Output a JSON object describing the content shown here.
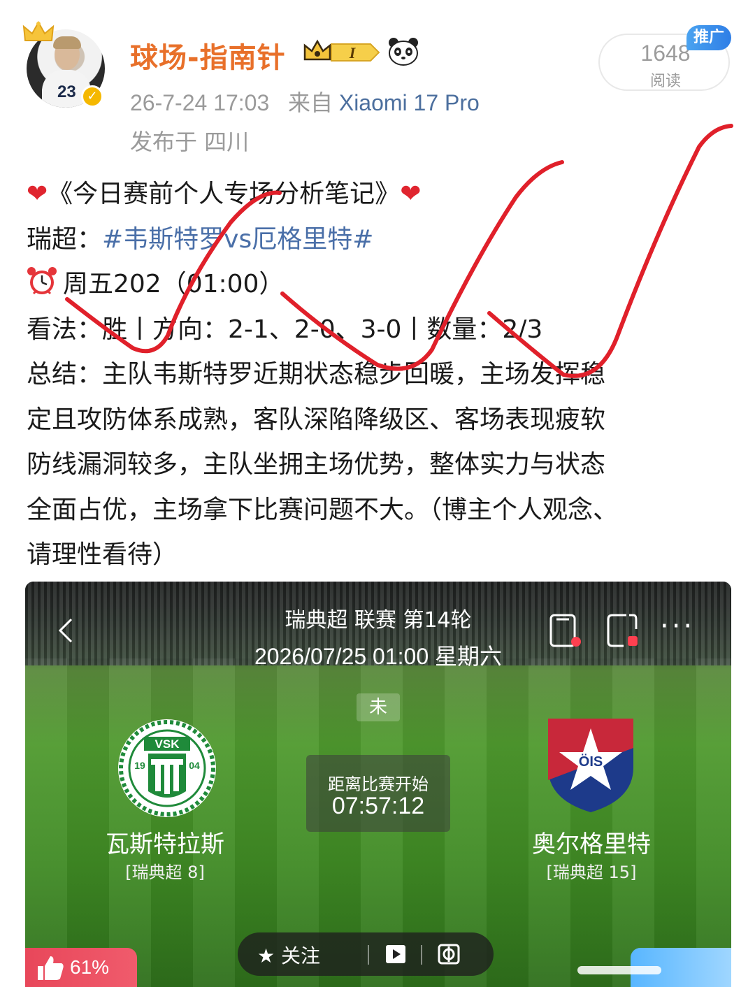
{
  "author": {
    "username": "球场-指南针",
    "level_badge": "I",
    "timestamp": "26-7-24 17:03",
    "source_prefix": "来自",
    "device": "Xiaomi 17 Pro",
    "location": "发布于 四川"
  },
  "stats": {
    "read_count": "1648",
    "read_label": "阅读",
    "promo_label": "推广"
  },
  "post": {
    "title": "《今日赛前个人专场分析笔记》",
    "league_prefix": "瑞超：",
    "match_tag": "#韦斯特罗vs厄格里特#",
    "time_text": "周五202（01:00）",
    "pick_text": "看法：胜丨方向：2-1、2-0、3-0丨数量：2/3",
    "summary_lines": [
      "总结：主队韦斯特罗近期状态稳步回暖，主场发挥稳",
      "定且攻防体系成熟，客队深陷降级区、客场表现疲软",
      "防线漏洞较多，主队坐拥主场优势，整体实力与状态",
      "全面占优，主场拿下比赛问题不大。（博主个人观念、",
      "请理性看待）"
    ]
  },
  "match_card": {
    "league_round": "瑞典超 联赛 第14轮",
    "datetime": "2026/07/25 01:00 星期六",
    "status": "未",
    "countdown_label": "距离比赛开始",
    "countdown_time": "07:57:12",
    "home": {
      "name": "瓦斯特拉斯",
      "rank": "[瑞典超 8]",
      "logo_text": "VSK",
      "logo_year_left": "19",
      "logo_year_right": "04"
    },
    "away": {
      "name": "奥尔格里特",
      "rank": "[瑞典超 15]",
      "logo_text": "ÖIS"
    },
    "follow_label": "关注",
    "like_percent": "61%"
  },
  "colors": {
    "username": "#e8702a",
    "link": "#4a6fa8",
    "check_marks": "#e0202a",
    "promo": "#2f7ee6"
  },
  "icons": [
    "crown-icon",
    "verified-icon",
    "level-badge-icon",
    "panda-icon",
    "heart-icon",
    "alarm-clock-icon",
    "back-icon",
    "phone-icon",
    "screen-record-icon",
    "more-icon",
    "star-icon",
    "play-icon",
    "switch-icon",
    "thumbs-up-icon"
  ]
}
